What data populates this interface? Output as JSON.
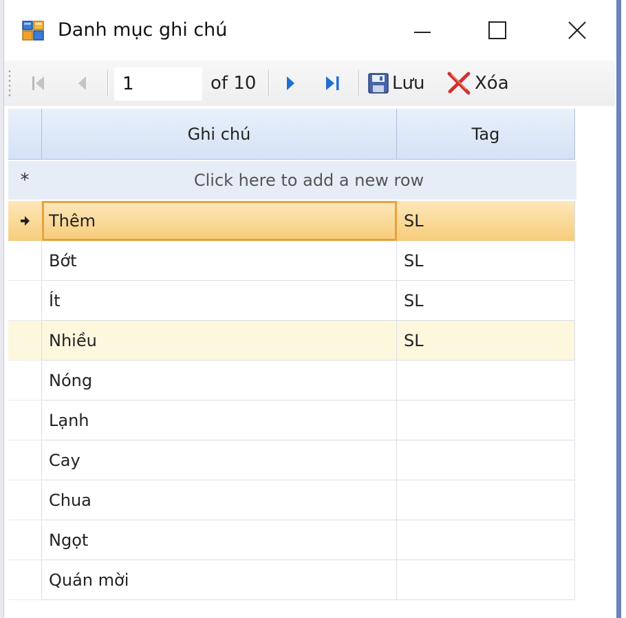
{
  "window": {
    "title": "Danh mục ghi chú",
    "buttons": [
      "minimize",
      "maximize",
      "close"
    ]
  },
  "navigator": {
    "position": "1",
    "count_label": "of 10",
    "save_label": "Lưu",
    "delete_label": "Xóa",
    "icons": [
      "first-record-icon",
      "previous-record-icon",
      "next-record-icon",
      "last-record-icon",
      "save-icon",
      "delete-icon"
    ]
  },
  "grid": {
    "columns": [
      "Ghi chú",
      "Tag"
    ],
    "new_row_text": "Click here to add a new row",
    "new_row_indicator": "*",
    "current_row_indicator": "arrow-right-icon",
    "rows": [
      {
        "ghi_chu": "Thêm",
        "tag": "SL"
      },
      {
        "ghi_chu": "Bớt",
        "tag": "SL"
      },
      {
        "ghi_chu": "Ít",
        "tag": "SL"
      },
      {
        "ghi_chu": "Nhiều",
        "tag": "SL"
      },
      {
        "ghi_chu": "Nóng",
        "tag": ""
      },
      {
        "ghi_chu": "Lạnh",
        "tag": ""
      },
      {
        "ghi_chu": "Cay",
        "tag": ""
      },
      {
        "ghi_chu": "Chua",
        "tag": ""
      },
      {
        "ghi_chu": "Ngọt",
        "tag": ""
      },
      {
        "ghi_chu": "Quán mời",
        "tag": ""
      }
    ],
    "selected_row": 0,
    "hover_row": 3
  },
  "colors": {
    "selection": "#f7cd7c",
    "hover": "#fdf7de",
    "header": "#d4e2f5",
    "new_row": "#e7edf7",
    "nav_arrow": "#1f6fd1",
    "delete_red": "#d0312d"
  }
}
